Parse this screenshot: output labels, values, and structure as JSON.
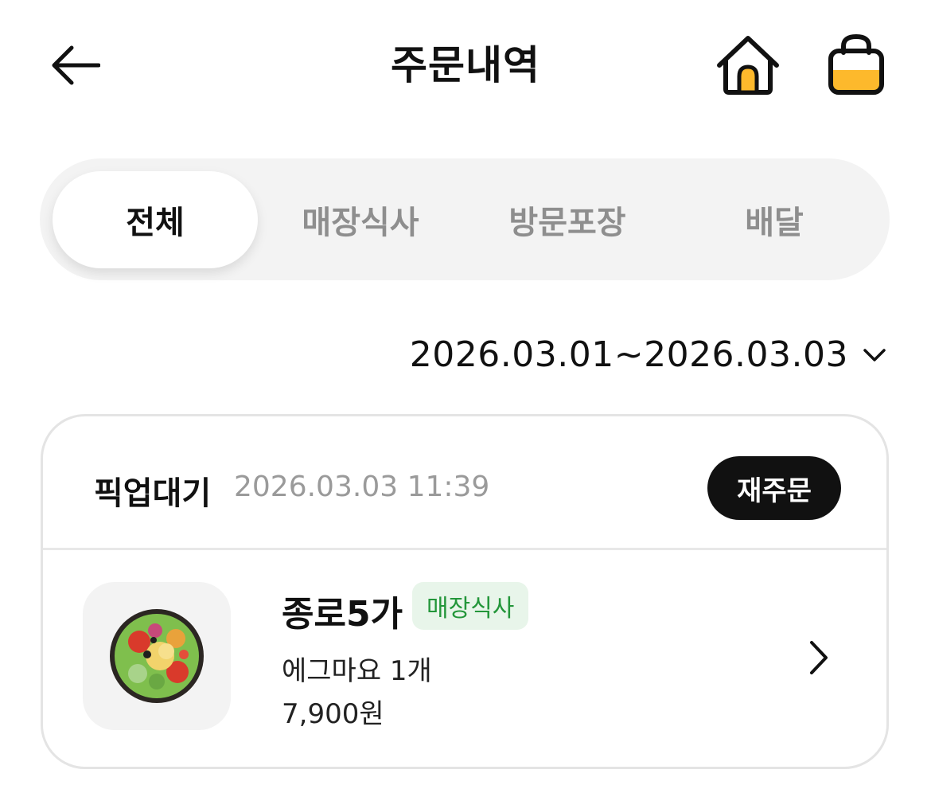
{
  "header": {
    "title": "주문내역",
    "back_icon": "arrow-left-icon",
    "home_icon": "home-icon",
    "cart_icon": "shopping-bag-icon"
  },
  "tabs": [
    {
      "label": "전체",
      "active": true
    },
    {
      "label": "매장식사",
      "active": false
    },
    {
      "label": "방문포장",
      "active": false
    },
    {
      "label": "배달",
      "active": false
    }
  ],
  "date_filter": {
    "range": "2026.03.01~2026.03.03",
    "icon": "chevron-down-icon"
  },
  "orders": [
    {
      "status": "픽업대기",
      "time": "2026.03.03 11:39",
      "reorder_label": "재주문",
      "store": "종로5가",
      "order_type": "매장식사",
      "item": "에그마요 1개",
      "price": "7,900원",
      "thumbnail_icon": "salad-bowl-image",
      "detail_icon": "chevron-right-icon"
    }
  ],
  "colors": {
    "accent_yellow": "#FDB92C",
    "badge_green": "#23963A",
    "badge_bg": "#E8F5EA",
    "dark": "#111111"
  }
}
